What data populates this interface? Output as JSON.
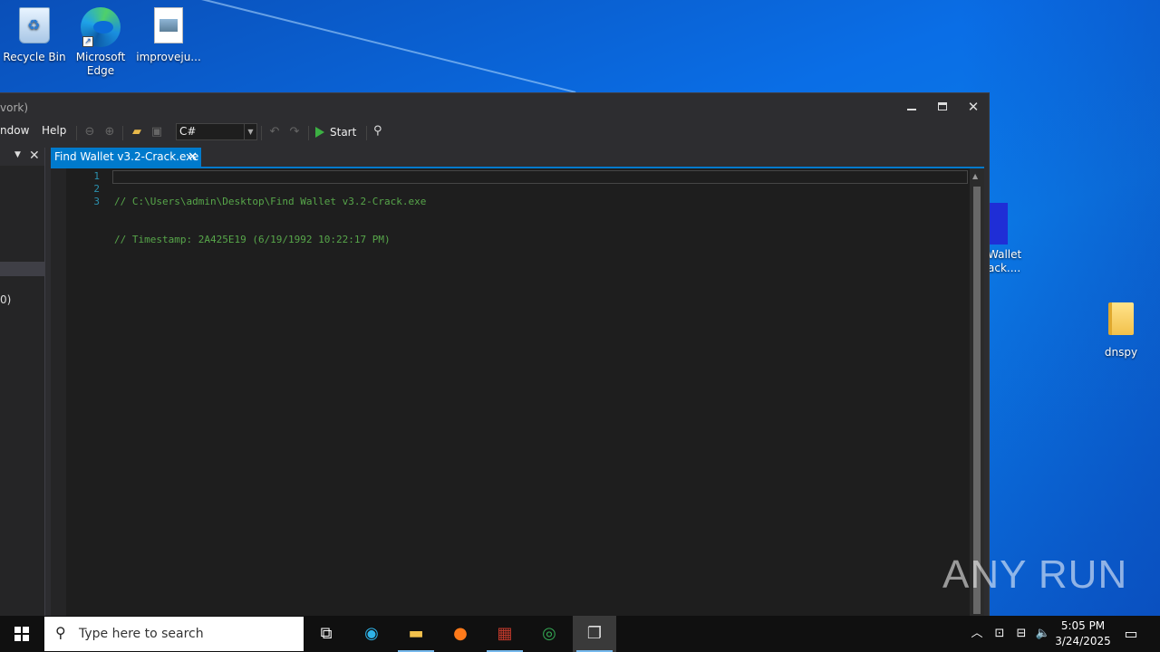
{
  "desktop": {
    "icons": [
      {
        "label": "Recycle Bin"
      },
      {
        "label": "Microsoft Edge"
      },
      {
        "label": "improveju..."
      },
      {
        "label": "dnspy"
      }
    ],
    "partial_icon_label": "Wallet\nack...."
  },
  "window": {
    "title": "vork)",
    "menu": {
      "window": "ndow",
      "help": "Help"
    },
    "language": "C#",
    "start_label": "Start",
    "left_pane_text": "0)",
    "tab": {
      "label": "Find Wallet v3.2-Crack.exe"
    },
    "code_lines": [
      {
        "num": "1",
        "text": "// C:\\Users\\admin\\Desktop\\Find Wallet v3.2-Crack.exe"
      },
      {
        "num": "2",
        "text": "// Timestamp: 2A425E19 (6/19/1992 10:22:17 PM)"
      },
      {
        "num": "3",
        "text": ""
      }
    ]
  },
  "taskbar": {
    "search_placeholder": "Type here to search",
    "time": "5:05 PM",
    "date": "3/24/2025"
  },
  "watermark": "ANY RUN"
}
